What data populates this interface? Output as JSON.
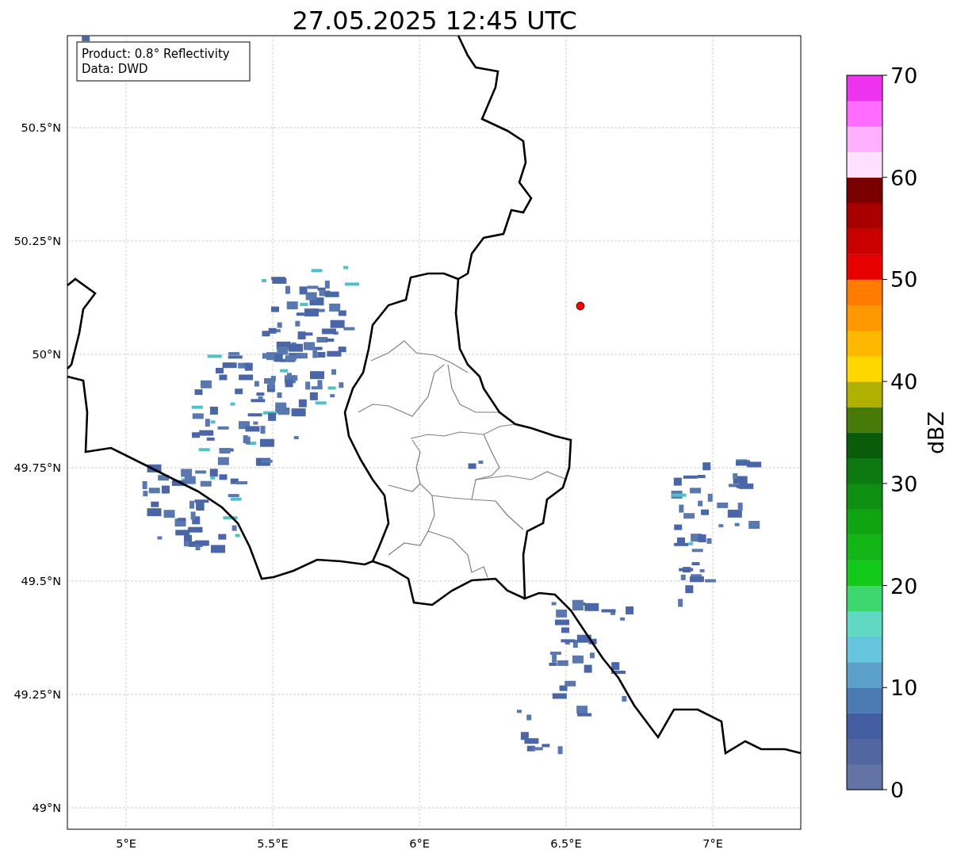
{
  "title": "27.05.2025 12:45 UTC",
  "info_box": {
    "lines": [
      "Product: 0.8° Reflectivity",
      "Data: DWD"
    ]
  },
  "map": {
    "lat_labels": [
      "50.5°N",
      "50.25°N",
      "50°N",
      "49.75°N",
      "49.5°N",
      "49.25°N",
      "49°N"
    ],
    "lon_labels": [
      "5°E",
      "5.5°E",
      "6°E",
      "6.5°E",
      "7°E"
    ]
  },
  "colorbar": {
    "label": "dBZ",
    "ticks": [
      "70",
      "60",
      "50",
      "40",
      "30",
      "20",
      "10",
      "0"
    ],
    "bins": [
      {
        "color": "#6473a6"
      },
      {
        "color": "#52679f"
      },
      {
        "color": "#435ea0"
      },
      {
        "color": "#4b7ab2"
      },
      {
        "color": "#5aa0c8"
      },
      {
        "color": "#66c4dc"
      },
      {
        "color": "#60d8c4"
      },
      {
        "color": "#3ed66e"
      },
      {
        "color": "#12c818"
      },
      {
        "color": "#12b616"
      },
      {
        "color": "#10a413"
      },
      {
        "color": "#0f8f12"
      },
      {
        "color": "#0c7a10"
      },
      {
        "color": "#0a5c0b"
      },
      {
        "color": "#487a0a"
      },
      {
        "color": "#b0b000"
      },
      {
        "color": "#ffd700"
      },
      {
        "color": "#ffb800"
      },
      {
        "color": "#ff9800"
      },
      {
        "color": "#ff7c00"
      },
      {
        "color": "#e60000"
      },
      {
        "color": "#c80000"
      },
      {
        "color": "#a80000"
      },
      {
        "color": "#7a0000"
      },
      {
        "color": "#ffe0ff"
      },
      {
        "color": "#ffb0ff"
      },
      {
        "color": "#ff6cff"
      },
      {
        "color": "#ee33ee"
      }
    ]
  }
}
